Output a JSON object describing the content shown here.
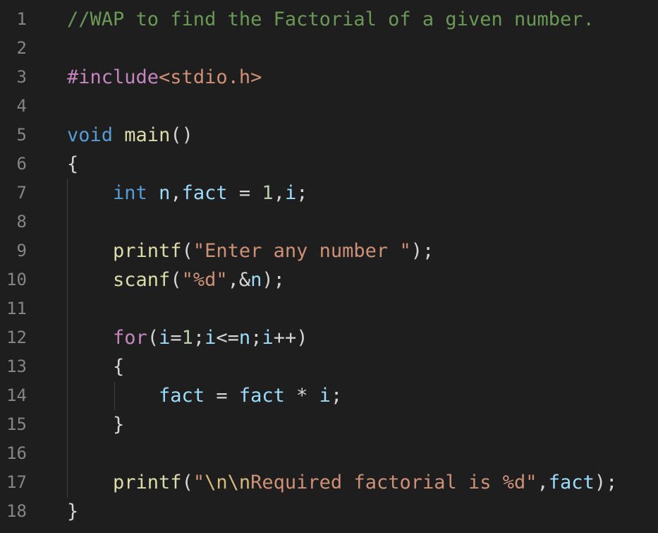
{
  "editor": {
    "theme_background": "#1e1e1e",
    "line_number_color": "#858585",
    "colors": {
      "comment": "#6a9955",
      "preprocessor": "#c586c0",
      "string": "#ce9178",
      "type_keyword": "#569cd6",
      "function": "#dcdcaa",
      "variable": "#9cdcfe",
      "number": "#b5cea8",
      "control_keyword": "#c586c0",
      "escape": "#d7ba7d",
      "punctuation": "#d4d4d4"
    },
    "lines": [
      {
        "number": "1",
        "tokens": [
          {
            "t": "comment",
            "v": "//WAP to find the Factorial of a given number."
          }
        ]
      },
      {
        "number": "2",
        "tokens": []
      },
      {
        "number": "3",
        "tokens": [
          {
            "t": "prep",
            "v": "#include"
          },
          {
            "t": "str",
            "v": "<stdio.h>"
          }
        ]
      },
      {
        "number": "4",
        "tokens": []
      },
      {
        "number": "5",
        "tokens": [
          {
            "t": "type",
            "v": "void"
          },
          {
            "t": "punc",
            "v": " "
          },
          {
            "t": "fn",
            "v": "main"
          },
          {
            "t": "punc",
            "v": "()"
          }
        ]
      },
      {
        "number": "6",
        "tokens": [
          {
            "t": "punc",
            "v": "{"
          }
        ]
      },
      {
        "number": "7",
        "tokens": [
          {
            "t": "punc",
            "v": "    "
          },
          {
            "t": "type",
            "v": "int"
          },
          {
            "t": "punc",
            "v": " "
          },
          {
            "t": "var",
            "v": "n"
          },
          {
            "t": "punc",
            "v": ","
          },
          {
            "t": "var",
            "v": "fact"
          },
          {
            "t": "punc",
            "v": " = "
          },
          {
            "t": "num",
            "v": "1"
          },
          {
            "t": "punc",
            "v": ","
          },
          {
            "t": "var",
            "v": "i"
          },
          {
            "t": "punc",
            "v": ";"
          }
        ]
      },
      {
        "number": "8",
        "tokens": []
      },
      {
        "number": "9",
        "tokens": [
          {
            "t": "punc",
            "v": "    "
          },
          {
            "t": "fn",
            "v": "printf"
          },
          {
            "t": "punc",
            "v": "("
          },
          {
            "t": "str",
            "v": "\"Enter any number \""
          },
          {
            "t": "punc",
            "v": ");"
          }
        ]
      },
      {
        "number": "10",
        "tokens": [
          {
            "t": "punc",
            "v": "    "
          },
          {
            "t": "fn",
            "v": "scanf"
          },
          {
            "t": "punc",
            "v": "("
          },
          {
            "t": "str",
            "v": "\"%d\""
          },
          {
            "t": "punc",
            "v": ",&"
          },
          {
            "t": "var",
            "v": "n"
          },
          {
            "t": "punc",
            "v": ");"
          }
        ]
      },
      {
        "number": "11",
        "tokens": []
      },
      {
        "number": "12",
        "tokens": [
          {
            "t": "punc",
            "v": "    "
          },
          {
            "t": "ctrl",
            "v": "for"
          },
          {
            "t": "punc",
            "v": "("
          },
          {
            "t": "var",
            "v": "i"
          },
          {
            "t": "punc",
            "v": "="
          },
          {
            "t": "num",
            "v": "1"
          },
          {
            "t": "punc",
            "v": ";"
          },
          {
            "t": "var",
            "v": "i"
          },
          {
            "t": "punc",
            "v": "<="
          },
          {
            "t": "var",
            "v": "n"
          },
          {
            "t": "punc",
            "v": ";"
          },
          {
            "t": "var",
            "v": "i"
          },
          {
            "t": "punc",
            "v": "++)"
          }
        ]
      },
      {
        "number": "13",
        "tokens": [
          {
            "t": "punc",
            "v": "    {"
          }
        ]
      },
      {
        "number": "14",
        "tokens": [
          {
            "t": "punc",
            "v": "        "
          },
          {
            "t": "var",
            "v": "fact"
          },
          {
            "t": "punc",
            "v": " = "
          },
          {
            "t": "var",
            "v": "fact"
          },
          {
            "t": "punc",
            "v": " * "
          },
          {
            "t": "var",
            "v": "i"
          },
          {
            "t": "punc",
            "v": ";"
          }
        ]
      },
      {
        "number": "15",
        "tokens": [
          {
            "t": "punc",
            "v": "    }"
          }
        ]
      },
      {
        "number": "16",
        "tokens": []
      },
      {
        "number": "17",
        "tokens": [
          {
            "t": "punc",
            "v": "    "
          },
          {
            "t": "fn",
            "v": "printf"
          },
          {
            "t": "punc",
            "v": "("
          },
          {
            "t": "str",
            "v": "\""
          },
          {
            "t": "esc",
            "v": "\\n\\n"
          },
          {
            "t": "str",
            "v": "Required factorial is %d\""
          },
          {
            "t": "punc",
            "v": ","
          },
          {
            "t": "var",
            "v": "fact"
          },
          {
            "t": "punc",
            "v": ");"
          }
        ]
      },
      {
        "number": "18",
        "tokens": [
          {
            "t": "punc",
            "v": "}"
          }
        ]
      }
    ]
  }
}
